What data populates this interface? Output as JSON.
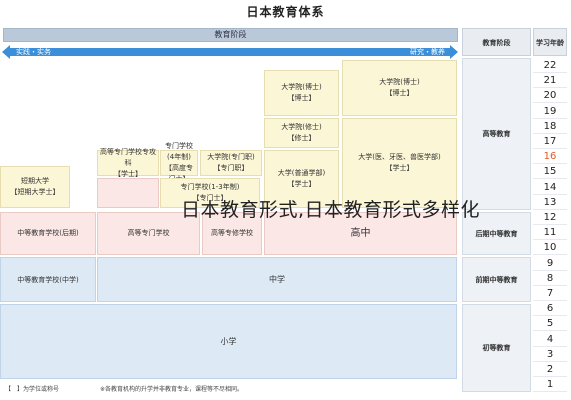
{
  "title": "日本教育体系",
  "header": {
    "stage_bar": "教育阶段",
    "left_arrow": "实践・实务",
    "right_arrow": "研究・教养",
    "stage_col": "教育阶段",
    "age_col": "学习年龄"
  },
  "ages": [
    "22",
    "21",
    "20",
    "19",
    "18",
    "17",
    "16",
    "15",
    "14",
    "13",
    "12",
    "11",
    "10",
    "9",
    "8",
    "7",
    "6",
    "5",
    "4",
    "3",
    "2",
    "1"
  ],
  "stages": {
    "higher": "高等教育",
    "upper_secondary": "后期中等教育",
    "lower_secondary": "前期中等教育",
    "primary": "初等教育"
  },
  "boxes": {
    "doctor": "大学院(博士)\n【博士】",
    "master": "大学院(修士)\n【修士】",
    "professional": "大学院(专门职)\n【专门职】",
    "university": "大学(普通学部)\n【学士】",
    "medical": "大学(医、牙医、兽医学部)\n【学士】",
    "junior_college": "短期大学\n【短期大学士】",
    "kosen_major": "高等专门学校专攻科\n【学士】",
    "vocational_4yr": "专门学校(4年制)\n【高度专门士】",
    "vocational_2yr": "专门学校(1-3年制)\n【专门士】",
    "high_school": "高中",
    "secondary_school_late": "中等教育学校(后期)",
    "kosen": "高等专门学校",
    "special_school": "高等专修学校",
    "middle_school": "中学",
    "secondary_school_early": "中等教育学校(中学)",
    "elementary": "小学"
  },
  "overlay_text": "日本教育形式,日本教育形式多样化",
  "footer": {
    "legend": "【　】为学位或称号",
    "note": "※各教育机构的升学并非教育专业，课程等不尽相同。"
  }
}
